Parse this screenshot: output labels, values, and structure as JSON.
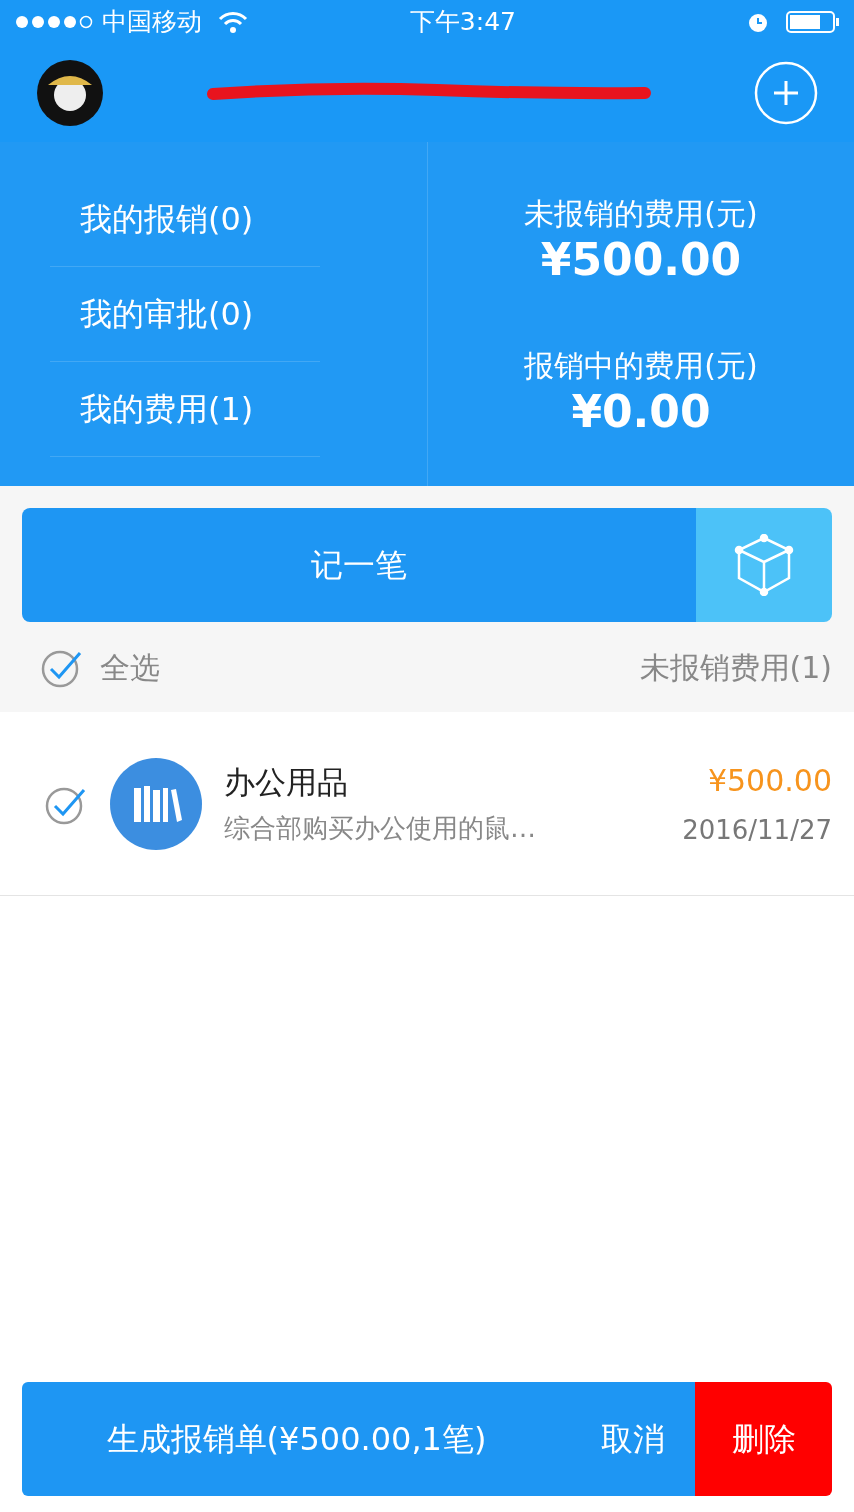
{
  "status_bar": {
    "carrier": "中国移动",
    "time": "下午3:47"
  },
  "summary": {
    "menu": [
      {
        "label": "我的报销(0)"
      },
      {
        "label": "我的审批(0)"
      },
      {
        "label": "我的费用(1)"
      }
    ],
    "figures": [
      {
        "label": "未报销的费用(元)",
        "amount": "¥500.00"
      },
      {
        "label": "报销中的费用(元)",
        "amount": "¥0.00"
      }
    ]
  },
  "record_button": "记一笔",
  "select_all": {
    "label": "全选",
    "checked": true
  },
  "list_count": "未报销费用(1)",
  "expenses": [
    {
      "title": "办公用品",
      "desc": "综合部购买办公使用的鼠…",
      "amount": "¥500.00",
      "date": "2016/11/27",
      "checked": true
    }
  ],
  "actions": [
    {
      "label": "生成报销单(¥500.00,1笔)",
      "kind": "primary"
    },
    {
      "label": "取消",
      "kind": "primary"
    },
    {
      "label": "删除",
      "kind": "danger"
    }
  ]
}
